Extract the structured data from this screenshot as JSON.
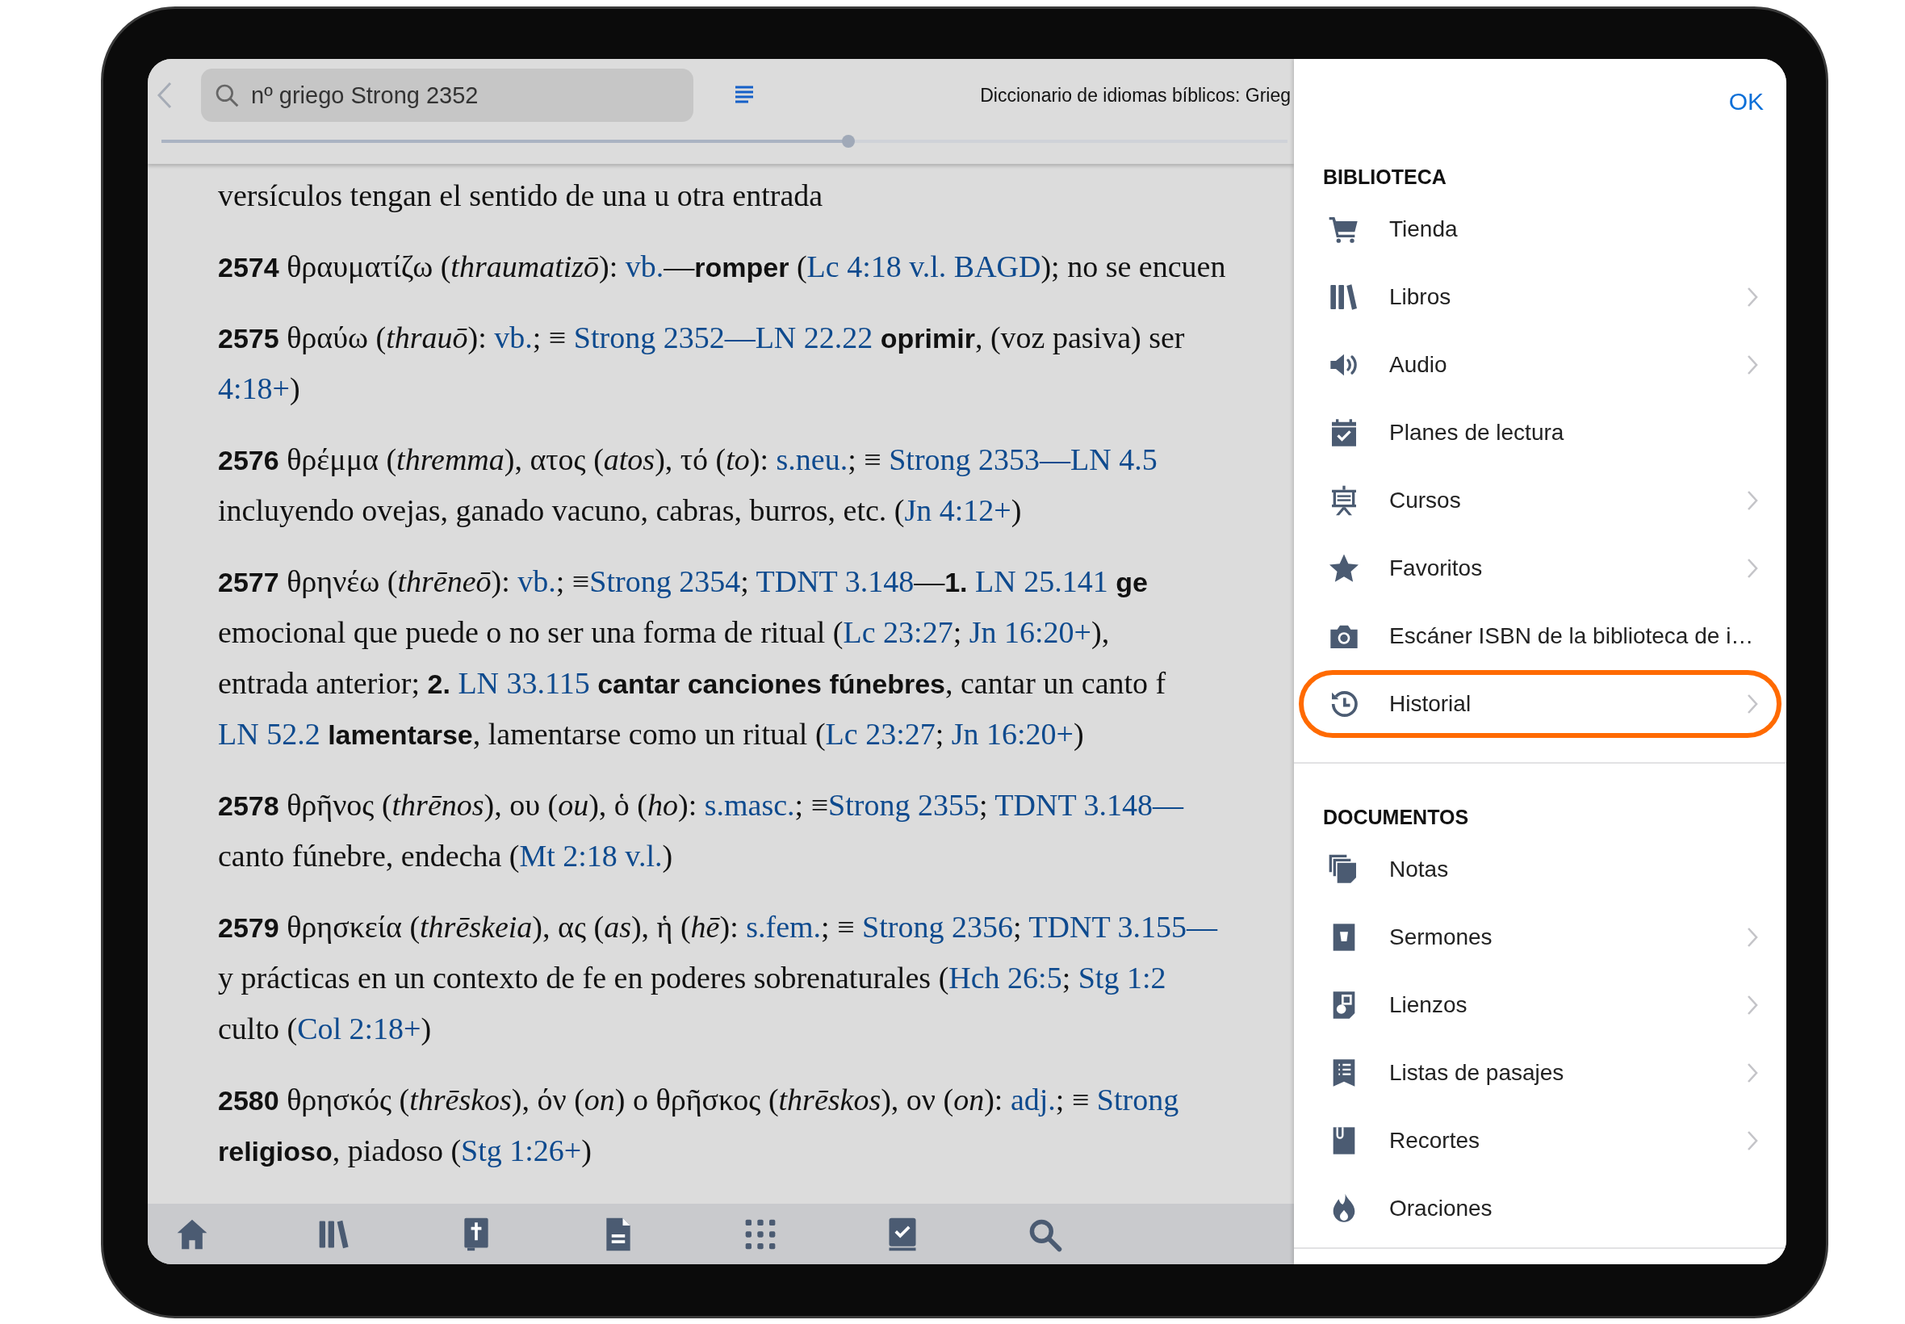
{
  "top_bar": {
    "search": {
      "value": "nº griego Strong 2352"
    },
    "title": "Diccionario de idiomas bíblicos: Grieg",
    "reading_progress": {
      "level": 0.61
    }
  },
  "entries": [
    {
      "lines": [
        [
          {
            "kind": "text",
            "text": "versículos tengan el sentido de una u otra entrada"
          }
        ]
      ]
    },
    {
      "lines": [
        [
          {
            "kind": "text",
            "text": "**2574** θραυματίζω (*thraumatizō*): "
          },
          {
            "kind": "link",
            "text": "vb."
          },
          {
            "kind": "text",
            "text": "—**romper** ("
          },
          {
            "kind": "link",
            "text": "Lc 4:18 v.l. BAGD"
          },
          {
            "kind": "text",
            "text": "); no se encuen"
          }
        ]
      ]
    },
    {
      "lines": [
        [
          {
            "kind": "text",
            "text": "**2575** θραύω (*thrauō*): "
          },
          {
            "kind": "link",
            "text": "vb."
          },
          {
            "kind": "text",
            "text": "; ≡ "
          },
          {
            "kind": "link",
            "text": "Strong 2352—LN 22.22"
          },
          {
            "kind": "text",
            "text": " **oprimir**, (voz pasiva) ser"
          }
        ],
        [
          {
            "kind": "link",
            "text": "4:18+"
          },
          {
            "kind": "text",
            "text": ")"
          }
        ]
      ]
    },
    {
      "lines": [
        [
          {
            "kind": "text",
            "text": "**2576** θρέμμα (*thremma*), ατος (*atos*), τό (*to*): "
          },
          {
            "kind": "link",
            "text": "s.neu."
          },
          {
            "kind": "text",
            "text": "; ≡ "
          },
          {
            "kind": "link",
            "text": "Strong 2353—LN 4.5"
          }
        ],
        [
          {
            "kind": "text",
            "text": "incluyendo ovejas, ganado vacuno, cabras, burros, etc. ("
          },
          {
            "kind": "link",
            "text": "Jn 4:12+"
          },
          {
            "kind": "text",
            "text": ")"
          }
        ]
      ]
    },
    {
      "lines": [
        [
          {
            "kind": "text",
            "text": "**2577** θρηνέω (*thrēneō*): "
          },
          {
            "kind": "link",
            "text": "vb."
          },
          {
            "kind": "text",
            "text": "; ≡"
          },
          {
            "kind": "link",
            "text": "Strong 2354"
          },
          {
            "kind": "text",
            "text": "; "
          },
          {
            "kind": "link",
            "text": "TDNT 3.148"
          },
          {
            "kind": "text",
            "text": "—**1.** "
          },
          {
            "kind": "link",
            "text": "LN 25.141"
          },
          {
            "kind": "text",
            "text": " **ge**"
          }
        ],
        [
          {
            "kind": "text",
            "text": "emocional que puede o no ser una forma de ritual ("
          },
          {
            "kind": "link",
            "text": "Lc 23:27"
          },
          {
            "kind": "text",
            "text": "; "
          },
          {
            "kind": "link",
            "text": "Jn 16:20+"
          },
          {
            "kind": "text",
            "text": "),"
          }
        ],
        [
          {
            "kind": "text",
            "text": "entrada anterior; **2.** "
          },
          {
            "kind": "link",
            "text": "LN 33.115"
          },
          {
            "kind": "text",
            "text": " **cantar canciones fúnebres**, cantar un canto f"
          }
        ],
        [
          {
            "kind": "link",
            "text": "LN 52.2"
          },
          {
            "kind": "text",
            "text": " **lamentarse**, lamentarse como un ritual ("
          },
          {
            "kind": "link",
            "text": "Lc 23:27"
          },
          {
            "kind": "text",
            "text": "; "
          },
          {
            "kind": "link",
            "text": "Jn 16:20+"
          },
          {
            "kind": "text",
            "text": ")"
          }
        ]
      ]
    },
    {
      "lines": [
        [
          {
            "kind": "text",
            "text": "**2578** θρῆνος (*thrēnos*), ου (*ou*), ὁ (*ho*): "
          },
          {
            "kind": "link",
            "text": "s.masc."
          },
          {
            "kind": "text",
            "text": "; ≡"
          },
          {
            "kind": "link",
            "text": "Strong 2355"
          },
          {
            "kind": "text",
            "text": "; "
          },
          {
            "kind": "link",
            "text": "TDNT 3.148—"
          }
        ],
        [
          {
            "kind": "text",
            "text": "canto fúnebre, endecha ("
          },
          {
            "kind": "link",
            "text": "Mt 2:18 v.l."
          },
          {
            "kind": "text",
            "text": ")"
          }
        ]
      ]
    },
    {
      "lines": [
        [
          {
            "kind": "text",
            "text": "**2579** θρησκεία (*thrēskeia*), ας (*as*), ἡ (*hē*): "
          },
          {
            "kind": "link",
            "text": "s.fem."
          },
          {
            "kind": "text",
            "text": "; ≡ "
          },
          {
            "kind": "link",
            "text": "Strong 2356"
          },
          {
            "kind": "text",
            "text": "; "
          },
          {
            "kind": "link",
            "text": "TDNT 3.155—"
          }
        ],
        [
          {
            "kind": "text",
            "text": "y prácticas en un contexto de fe en poderes sobrenaturales ("
          },
          {
            "kind": "link",
            "text": "Hch 26:5"
          },
          {
            "kind": "text",
            "text": "; "
          },
          {
            "kind": "link",
            "text": "Stg 1:2"
          }
        ],
        [
          {
            "kind": "text",
            "text": "culto ("
          },
          {
            "kind": "link",
            "text": "Col 2:18+"
          },
          {
            "kind": "text",
            "text": ")"
          }
        ]
      ]
    },
    {
      "lines": [
        [
          {
            "kind": "text",
            "text": "**2580** θρησκός (*thrēskos*), όν (*on*) o θρῆσκος (*thrēskos*), ον (*on*): "
          },
          {
            "kind": "link",
            "text": "adj."
          },
          {
            "kind": "text",
            "text": "; ≡ "
          },
          {
            "kind": "link",
            "text": "Strong"
          }
        ],
        [
          {
            "kind": "text",
            "text": "**religioso**, piadoso ("
          },
          {
            "kind": "link",
            "text": "Stg 1:26+"
          },
          {
            "kind": "text",
            "text": ")"
          }
        ]
      ]
    }
  ],
  "panel": {
    "done_button": "OK",
    "sections": [
      {
        "header": "BIBLIOTECA",
        "items": [
          {
            "label": "Tienda",
            "chevron": false,
            "highlighted": false
          },
          {
            "label": "Libros",
            "chevron": true,
            "highlighted": false
          },
          {
            "label": "Audio",
            "chevron": true,
            "highlighted": false
          },
          {
            "label": "Planes de lectura",
            "chevron": false,
            "highlighted": false
          },
          {
            "label": "Cursos",
            "chevron": true,
            "highlighted": false
          },
          {
            "label": "Favoritos",
            "chevron": true,
            "highlighted": false
          },
          {
            "label": "Escáner ISBN de la biblioteca de i…",
            "chevron": false,
            "highlighted": false
          },
          {
            "label": "Historial",
            "chevron": true,
            "highlighted": true
          }
        ]
      },
      {
        "header": "DOCUMENTOS",
        "items": [
          {
            "label": "Notas",
            "chevron": false,
            "highlighted": false
          },
          {
            "label": "Sermones",
            "chevron": true,
            "highlighted": false
          },
          {
            "label": "Lienzos",
            "chevron": true,
            "highlighted": false
          },
          {
            "label": "Listas de pasajes",
            "chevron": true,
            "highlighted": false
          },
          {
            "label": "Recortes",
            "chevron": true,
            "highlighted": false
          },
          {
            "label": "Oraciones",
            "chevron": false,
            "highlighted": false
          }
        ]
      }
    ]
  }
}
